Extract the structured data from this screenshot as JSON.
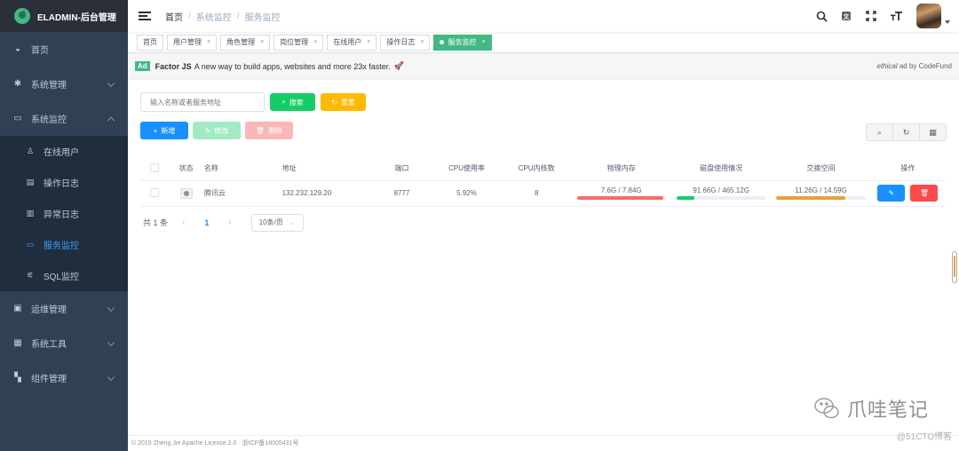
{
  "sidebar": {
    "logo_title": "ELADMIN-后台管理",
    "items": [
      {
        "label": "首页",
        "icon": "dashboard-icon"
      },
      {
        "label": "系统管理",
        "icon": "gear-icon"
      },
      {
        "label": "系统监控",
        "icon": "monitor-icon"
      },
      {
        "label": "运维管理",
        "icon": "ops-icon"
      },
      {
        "label": "系统工具",
        "icon": "toolbox-icon"
      },
      {
        "label": "组件管理",
        "icon": "grid-icon"
      }
    ],
    "monitor_sub": [
      {
        "label": "在线用户",
        "icon": "user-icon"
      },
      {
        "label": "操作日志",
        "icon": "log-icon"
      },
      {
        "label": "异常日志",
        "icon": "error-log-icon"
      },
      {
        "label": "服务监控",
        "icon": "server-icon",
        "active": true
      },
      {
        "label": "SQL监控",
        "icon": "sql-icon"
      }
    ]
  },
  "navbar": {
    "breadcrumb": [
      "首页",
      "系统监控",
      "服务监控"
    ],
    "breadcrumb_sep": "/"
  },
  "tags": [
    {
      "label": "首页",
      "closable": false
    },
    {
      "label": "用户管理",
      "closable": true
    },
    {
      "label": "角色管理",
      "closable": true
    },
    {
      "label": "岗位管理",
      "closable": true
    },
    {
      "label": "在线用户",
      "closable": true
    },
    {
      "label": "操作日志",
      "closable": true
    },
    {
      "label": "服务监控",
      "closable": true,
      "active": true
    }
  ],
  "tag_close": "×",
  "ad": {
    "badge": "Ad",
    "title": "Factor JS",
    "text": "A new way to build apps, websites and more 23x faster.",
    "right_italic": "ethical",
    "right_text": " ad by CodeFund"
  },
  "filters": {
    "search_placeholder": "输入名称或者服务地址",
    "search_button": "搜索",
    "reset_button": "重置"
  },
  "actions": {
    "add": "新增",
    "edit": "修改",
    "delete": "删除"
  },
  "table": {
    "headers": [
      "状态",
      "名称",
      "地址",
      "端口",
      "CPU使用率",
      "CPU内核数",
      "物理内存",
      "磁盘使用情况",
      "交换空间",
      "操作"
    ],
    "rows": [
      {
        "name": "腾讯云",
        "address": "132.232.129.20",
        "port": "8777",
        "cpu_rate": "5.92%",
        "cpu_cores": "8",
        "memory": {
          "text": "7.6G / 7.84G",
          "percent": 97,
          "color": "#f56c6c"
        },
        "disk": {
          "text": "91.66G / 465.12G",
          "percent": 20,
          "color": "#13ce66"
        },
        "swap": {
          "text": "11.26G / 14.59G",
          "percent": 77,
          "color": "#e6a23c"
        }
      }
    ]
  },
  "pagination": {
    "total": "共 1 条",
    "prev": "‹",
    "page": "1",
    "next": "›",
    "size": "10条/页"
  },
  "footer": "© 2019 Zheng Jie Apache License 2.0 · 浙ICP备18005431号",
  "watermark": {
    "text": "爪哇笔记",
    "sub": "@51CTO博客"
  }
}
